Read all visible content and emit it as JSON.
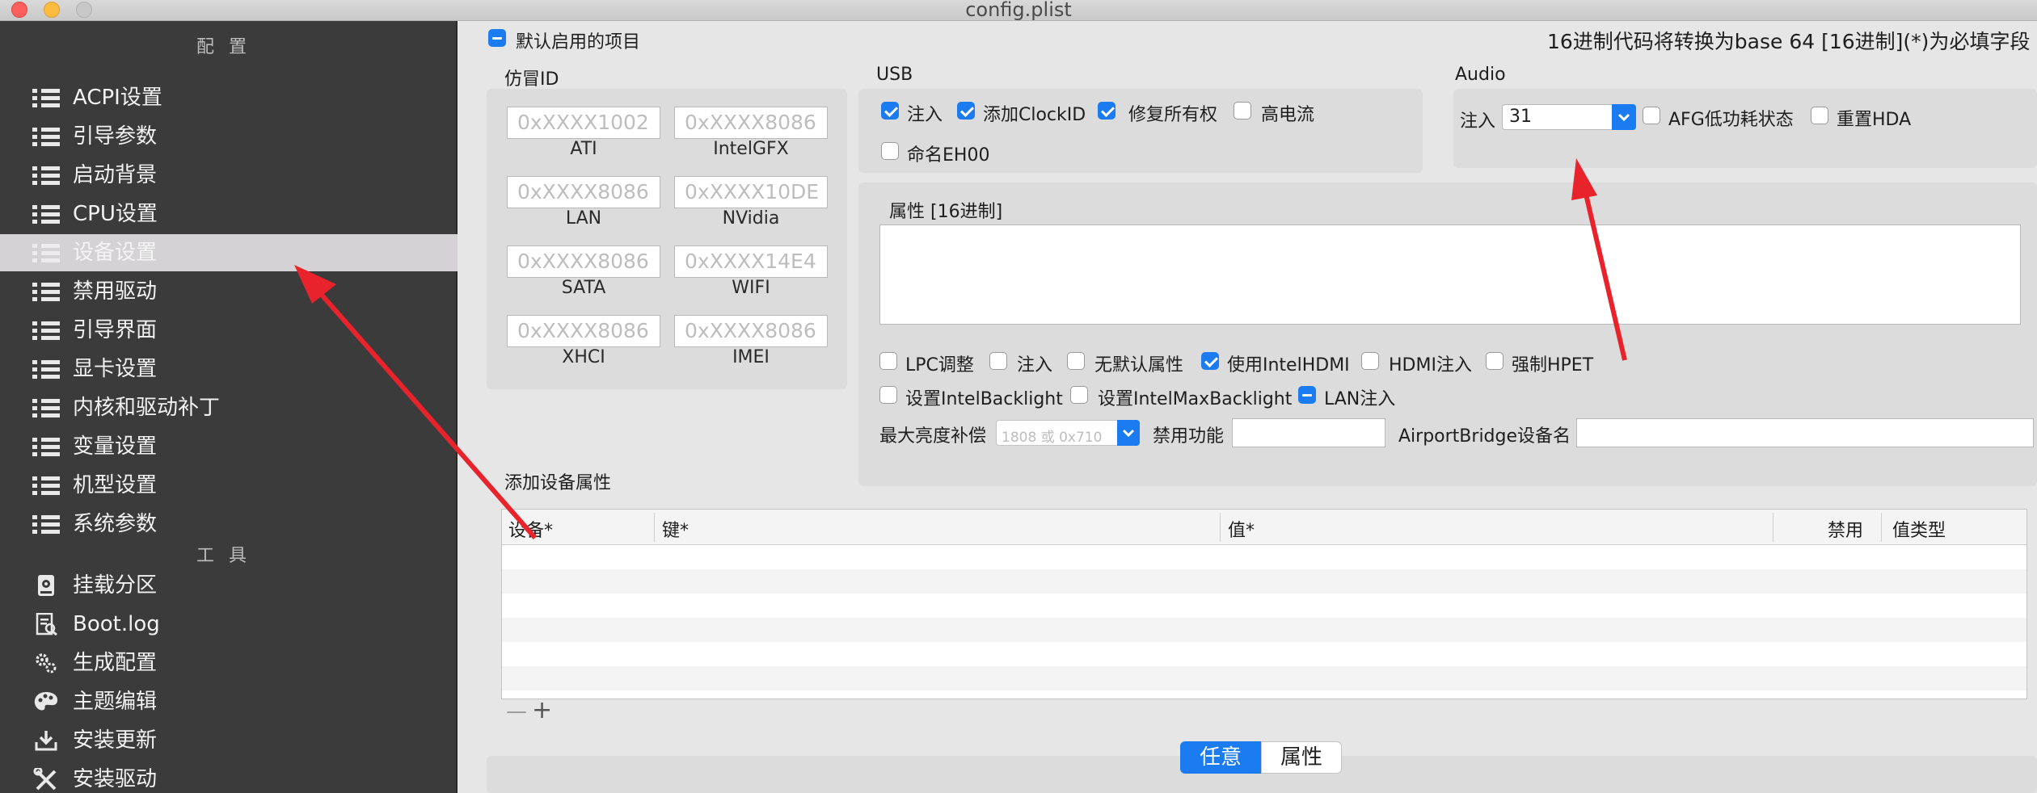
{
  "window": {
    "title": "config.plist"
  },
  "sidebar": {
    "config_header": "配置",
    "tools_header": "工具",
    "items": [
      {
        "label": "ACPI设置"
      },
      {
        "label": "引导参数"
      },
      {
        "label": "启动背景"
      },
      {
        "label": "CPU设置"
      },
      {
        "label": "设备设置",
        "selected": true
      },
      {
        "label": "禁用驱动"
      },
      {
        "label": "引导界面"
      },
      {
        "label": "显卡设置"
      },
      {
        "label": "内核和驱动补丁"
      },
      {
        "label": "变量设置"
      },
      {
        "label": "机型设置"
      },
      {
        "label": "系统参数"
      }
    ],
    "tools": [
      {
        "label": "挂载分区",
        "icon": "disk-icon"
      },
      {
        "label": "Boot.log",
        "icon": "log-icon"
      },
      {
        "label": "生成配置",
        "icon": "gears-icon"
      },
      {
        "label": "主题编辑",
        "icon": "palette-icon"
      },
      {
        "label": "安装更新",
        "icon": "download-icon"
      },
      {
        "label": "安装驱动",
        "icon": "tools-icon"
      }
    ]
  },
  "main": {
    "enable_default": "默认启用的项目",
    "hint": "16进制代码将转换为base 64 [16进制](*)为必填字段",
    "fake_id": {
      "title": "仿冒ID",
      "fields": [
        {
          "placeholder": "0xXXXX1002",
          "caption": "ATI"
        },
        {
          "placeholder": "0xXXXX8086",
          "caption": "IntelGFX"
        },
        {
          "placeholder": "0xXXXX8086",
          "caption": "LAN"
        },
        {
          "placeholder": "0xXXXX10DE",
          "caption": "NVidia"
        },
        {
          "placeholder": "0xXXXX8086",
          "caption": "SATA"
        },
        {
          "placeholder": "0xXXXX14E4",
          "caption": "WIFI"
        },
        {
          "placeholder": "0xXXXX8086",
          "caption": "XHCI"
        },
        {
          "placeholder": "0xXXXX8086",
          "caption": "IMEI"
        }
      ]
    },
    "usb": {
      "title": "USB",
      "options": [
        {
          "label": "注入",
          "checked": true
        },
        {
          "label": "添加ClockID",
          "checked": true
        },
        {
          "label": "修复所有权",
          "checked": true
        },
        {
          "label": "高电流",
          "checked": false
        },
        {
          "label": "命名EH00",
          "checked": false
        }
      ]
    },
    "audio": {
      "title": "Audio",
      "inject_label": "注入",
      "inject_value": "31",
      "afg_label": "AFG低功耗状态",
      "reset_hda_label": "重置HDA"
    },
    "properties": {
      "title": "属性 [16进制]",
      "options": [
        {
          "label": "LPC调整",
          "checked": false
        },
        {
          "label": "注入",
          "checked": false
        },
        {
          "label": "无默认属性",
          "checked": false
        },
        {
          "label": "使用IntelHDMI",
          "checked": true
        },
        {
          "label": "HDMI注入",
          "checked": false
        },
        {
          "label": "强制HPET",
          "checked": false
        },
        {
          "label": "设置IntelBacklight",
          "checked": false
        },
        {
          "label": "设置IntelMaxBacklight",
          "checked": false
        },
        {
          "label": "LAN注入",
          "checked": "mixed"
        }
      ],
      "max_brightness_label": "最大亮度补偿",
      "max_brightness_placeholder": "1808 或 0x710",
      "disable_features_label": "禁用功能",
      "airport_label": "AirportBridge设备名"
    },
    "add_props": {
      "title": "添加设备属性",
      "columns": [
        "设备*",
        "键*",
        "值*",
        "禁用",
        "值类型"
      ],
      "minus": "—",
      "plus": "+"
    },
    "segmented": {
      "left": "任意",
      "right": "属性"
    }
  }
}
